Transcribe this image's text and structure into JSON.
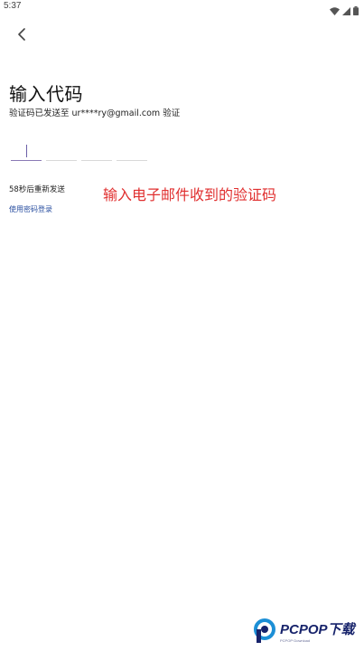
{
  "status_bar": {
    "time": "5:37",
    "icons": [
      "wifi-icon",
      "signal-icon",
      "battery-icon"
    ]
  },
  "nav": {
    "back_icon": "chevron-left-icon"
  },
  "main": {
    "title": "输入代码",
    "subtitle": "验证码已发送至 ur****ry@gmail.com 验证",
    "code_box_count": 4,
    "resend_text": "58秒后重新发送",
    "password_link": "使用密码登录"
  },
  "annotation": {
    "text": "输入电子邮件收到的验证码",
    "color": "#e02f2f"
  },
  "watermark": {
    "text": "PCPOP下载",
    "subtext": "PCPOP·Download",
    "color": "#17236b"
  },
  "colors": {
    "accent": "#6b5fa8",
    "link": "#2a4fa0"
  }
}
